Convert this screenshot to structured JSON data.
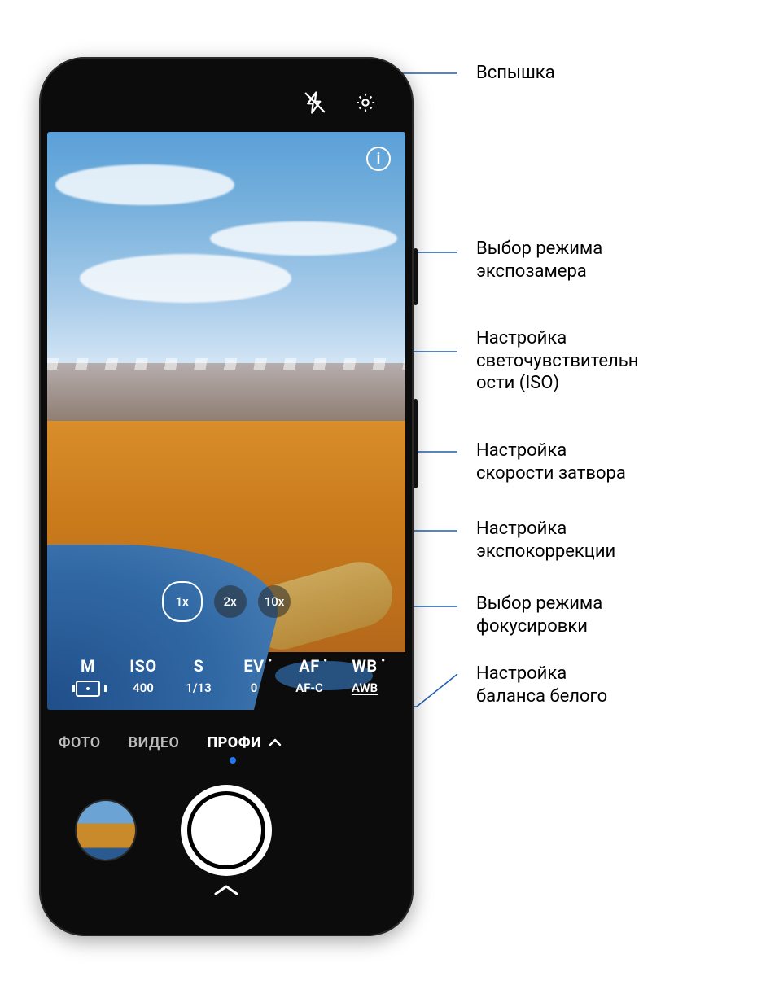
{
  "callouts": {
    "flash": "Вспышка",
    "metering": "Выбор режима\nэкспозамера",
    "iso": "Настройка\nсветочувствительн\nости  (ISO)",
    "shutter": "Настройка\nскорости затвора",
    "ev": "Настройка\nэкспокоррекции",
    "focus": "Выбор режима\nфокусировки",
    "wb": "Настройка\nбаланса  белого"
  },
  "top": {
    "info": "i"
  },
  "zoom": {
    "z1": "1x",
    "z2": "2x",
    "z10": "10x"
  },
  "pro": {
    "m": {
      "label": "M"
    },
    "iso": {
      "label": "ISO",
      "val": "400"
    },
    "s": {
      "label": "S",
      "val": "1/13"
    },
    "ev": {
      "label": "EV",
      "val": "0"
    },
    "af": {
      "label": "AF",
      "val": "AF-C"
    },
    "wb": {
      "label": "WB",
      "val": "AWB"
    }
  },
  "modes": {
    "photo": "ФОТО",
    "video": "ВИДЕО",
    "pro": "ПРОФИ"
  }
}
